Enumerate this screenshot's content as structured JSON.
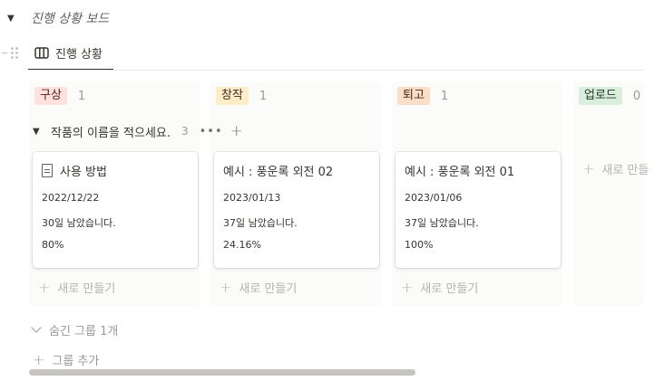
{
  "header": {
    "title": "진행 상황 보드"
  },
  "view_tab": {
    "label": "진행 상황"
  },
  "columns": [
    {
      "label": "구상",
      "count": "1",
      "bg": "#ffe2dd",
      "color": "#5d1715"
    },
    {
      "label": "창작",
      "count": "1",
      "bg": "#fdecc8",
      "color": "#402c1b"
    },
    {
      "label": "퇴고",
      "count": "1",
      "bg": "#fadec9",
      "color": "#49290e"
    },
    {
      "label": "업로드",
      "count": "0",
      "bg": "#dbeddb",
      "color": "#1c3829"
    }
  ],
  "group": {
    "title": "작품의 이름을 적으세요.",
    "count": "3",
    "more": "•••",
    "add": "+"
  },
  "cards": [
    {
      "title": "사용 방법",
      "date": "2022/12/22",
      "remaining": "30일 남았습니다.",
      "progress": "80%",
      "icon": "page-icon"
    },
    {
      "title": "예시 : 풍운록 외전 02",
      "date": "2023/01/13",
      "remaining": "37일 남았습니다.",
      "progress": "24.16%"
    },
    {
      "title": "예시 : 풍운록 외전 01",
      "date": "2023/01/06",
      "remaining": "37일 남았습니다.",
      "progress": "100%"
    }
  ],
  "new_label": "새로 만들기",
  "new_label_partial": "새로 만들",
  "hidden_groups": "숨긴 그룹 1개",
  "add_group": "그룹 추가"
}
